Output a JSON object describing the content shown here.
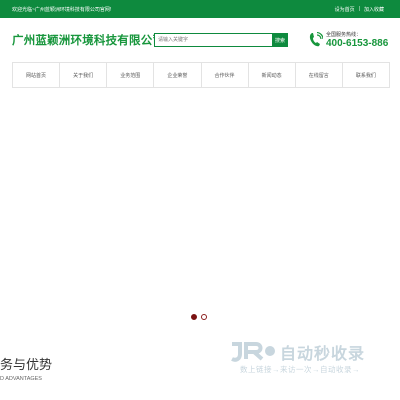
{
  "topbar": {
    "welcome": "欢迎光临~广州蓝颖洲环境科技有限公司官网!",
    "links": [
      "设为首页",
      "|",
      "加入收藏"
    ]
  },
  "header": {
    "company_name": "广州蓝颖洲环境科技有限公司",
    "search_placeholder": "请输入关键字",
    "search_button": "搜索",
    "hotline_label": "全国服务热线：",
    "hotline": "400-6153-886"
  },
  "nav": {
    "items": [
      "网站首页",
      "关于我们",
      "业务范围",
      "企业荣誉",
      "合作伙伴",
      "新闻动态",
      "在线留言",
      "联系我们"
    ]
  },
  "carousel": {
    "slides": 2,
    "active_index": 0
  },
  "section": {
    "title": "务与优势",
    "subtitle": "D ADVANTAGES"
  },
  "watermark": {
    "logo_text": "JR",
    "title": "自动秒收录",
    "subtitle": "数上链接→来访一次→自动收录→"
  },
  "colors": {
    "primary": "#0e8a3e",
    "brand_text": "#17963c",
    "dot_active": "#7a1212",
    "watermark": "#c8d6de"
  }
}
